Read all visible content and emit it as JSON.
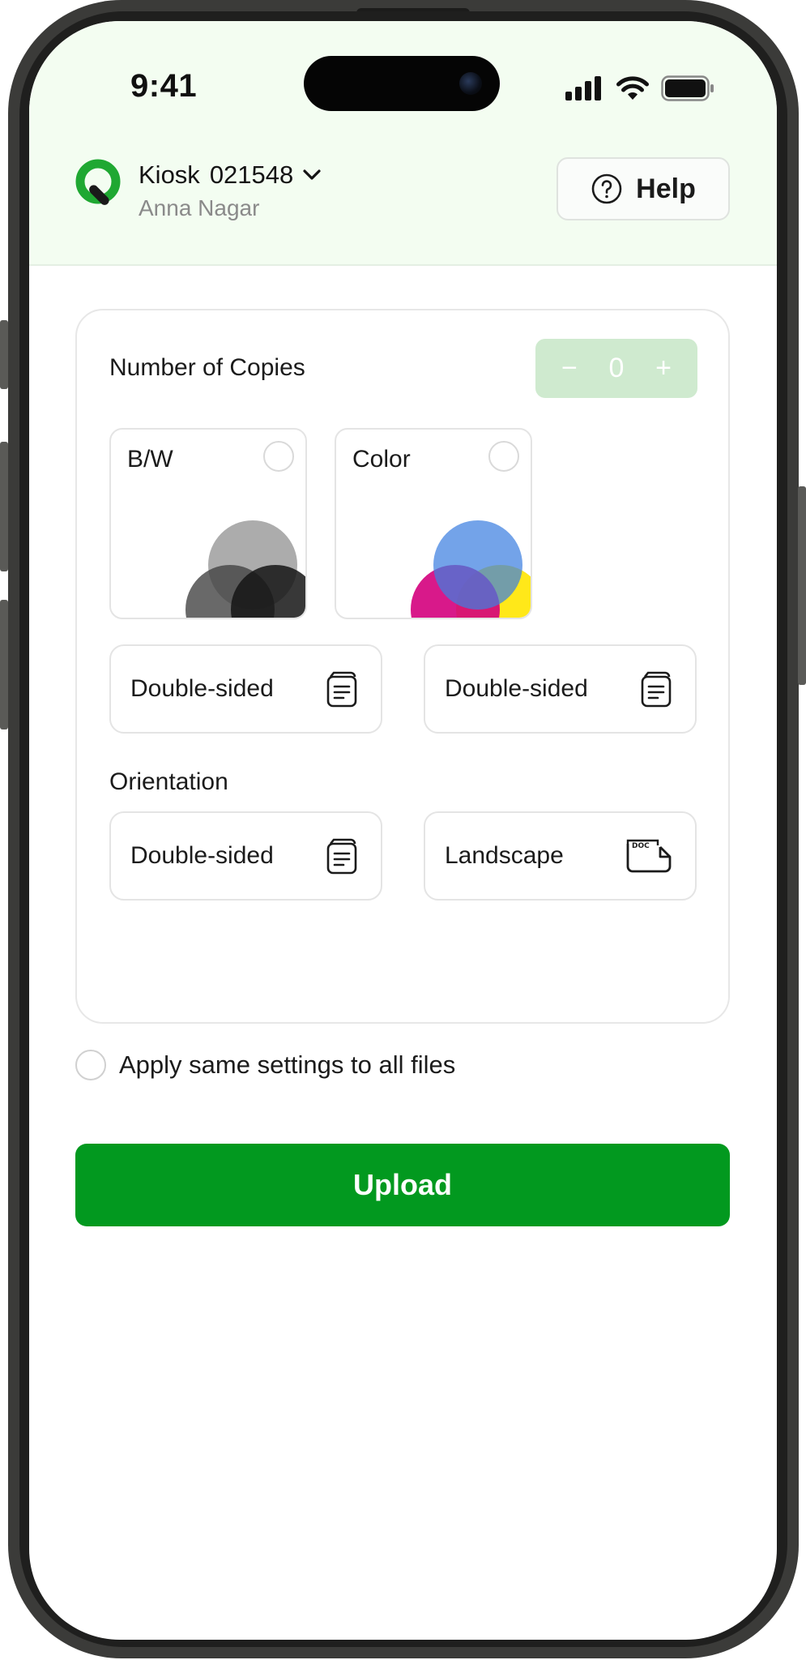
{
  "status_bar": {
    "time": "9:41"
  },
  "header": {
    "kiosk_name": "Kiosk",
    "kiosk_id": "021548",
    "location": "Anna Nagar",
    "help_label": "Help"
  },
  "settings": {
    "copies_label": "Number of Copies",
    "copies_value": "0",
    "decrement_symbol": "−",
    "increment_symbol": "+",
    "color_modes": [
      {
        "label": "B/W",
        "selected": false
      },
      {
        "label": "Color",
        "selected": false
      }
    ],
    "sides_options": [
      {
        "label": "Double-sided"
      },
      {
        "label": "Double-sided"
      }
    ],
    "orientation_label": "Orientation",
    "orientation_options": [
      {
        "label": "Double-sided"
      },
      {
        "label": "Landscape"
      }
    ]
  },
  "apply_all": {
    "label": "Apply same settings to all files",
    "checked": false
  },
  "upload": {
    "label": "Upload"
  },
  "colors": {
    "brand_green": "#02991f",
    "header_bg": "#f3fdf1",
    "stepper_bg": "#cfeacf",
    "border": "#e4e4e4"
  }
}
